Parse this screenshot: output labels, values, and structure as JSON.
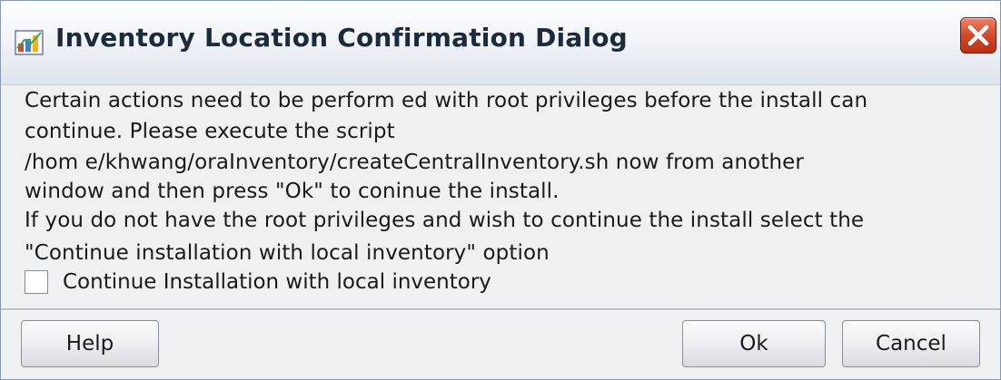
{
  "window": {
    "title": "Inventory Location Confirmation Dialog",
    "icon": "installer-icon",
    "close_icon": "close-icon"
  },
  "message": {
    "lines": [
      "Certain actions need to be perform ed with root privileges before the install can",
      "continue. Please execute the script",
      "/hom e/khwang/oraInventory/createCentralInventory.sh now from another",
      "window and then press \"Ok\" to coninue the install.",
      "If you do not have the root privileges and wish to continue the install select the",
      "\"Continue installation with local inventory\" option"
    ]
  },
  "checkbox": {
    "label": "Continue Installation with local inventory",
    "checked": false
  },
  "buttons": {
    "help": "Help",
    "ok": "Ok",
    "cancel": "Cancel"
  },
  "colors": {
    "title_text": "#1c2a3a",
    "close_button": "#d24a2c",
    "dialog_background": "#eef0f2"
  }
}
